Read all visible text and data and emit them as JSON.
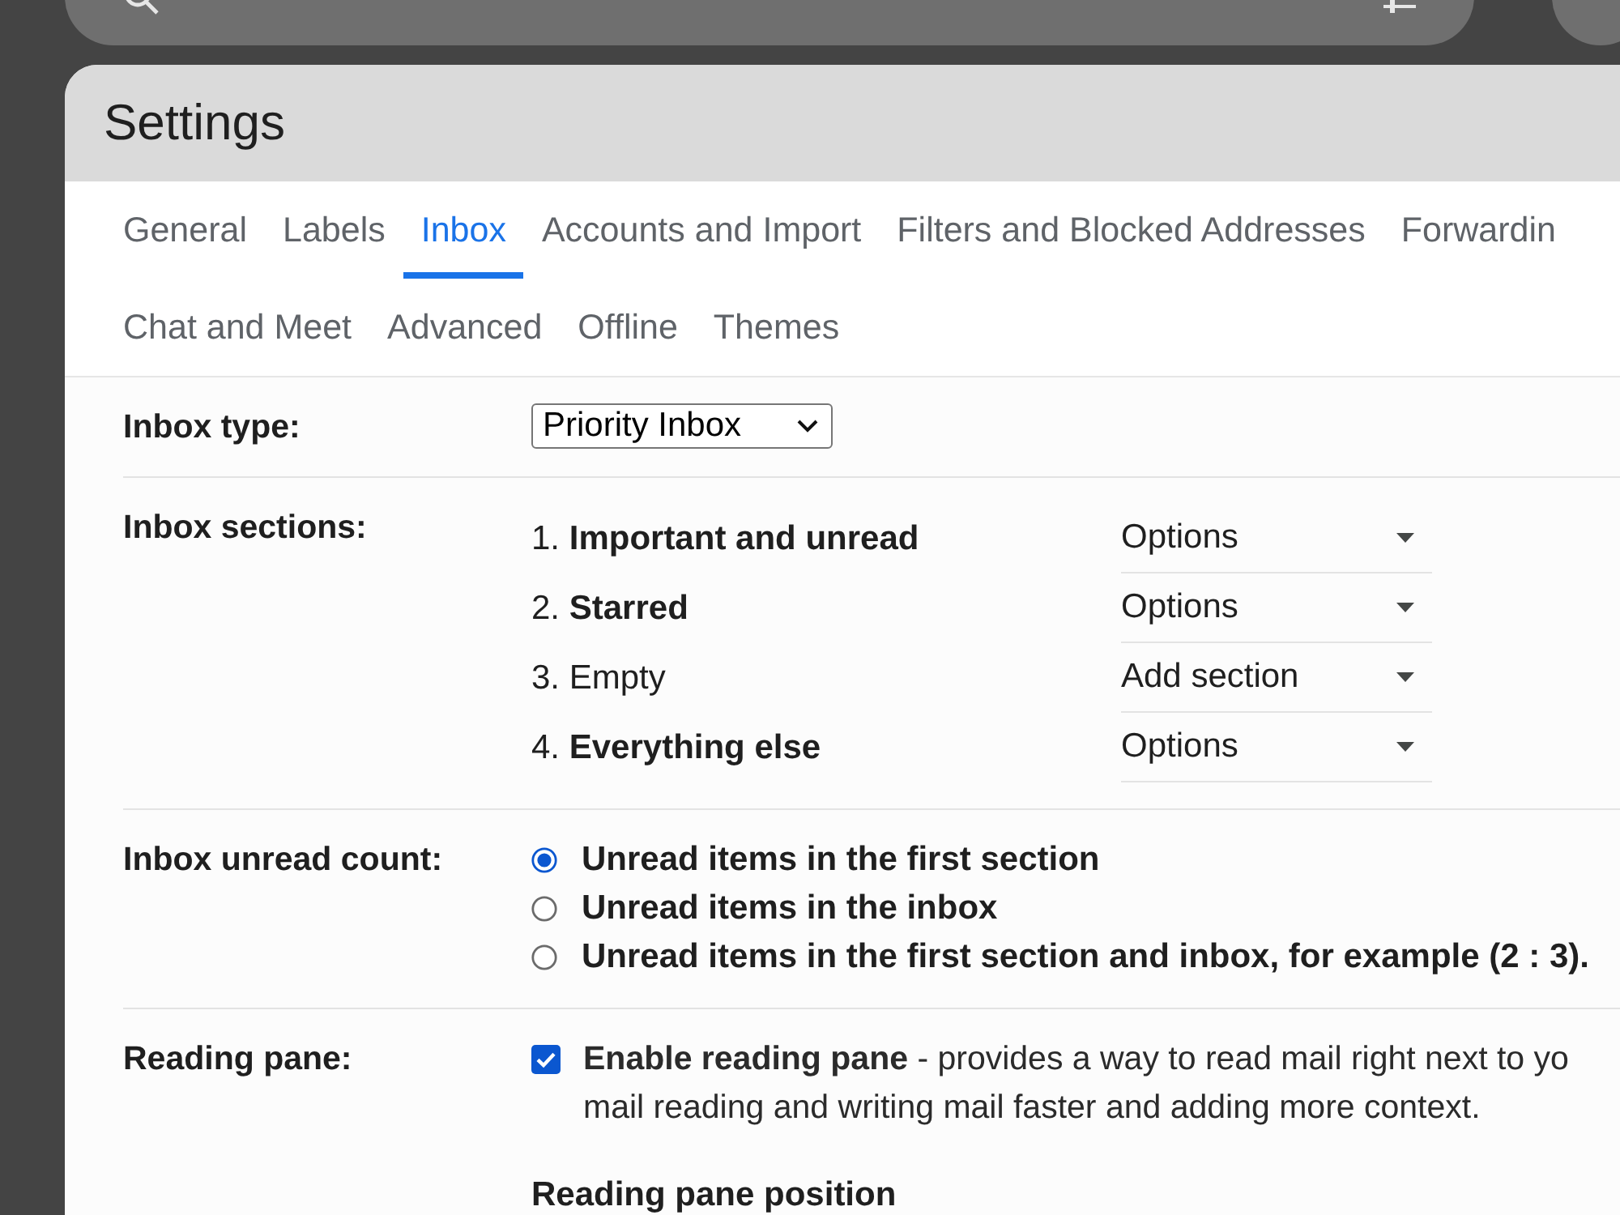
{
  "header": {
    "title": "Settings"
  },
  "tab_rows": [
    [
      {
        "label": "General",
        "selected": false
      },
      {
        "label": "Labels",
        "selected": false
      },
      {
        "label": "Inbox",
        "selected": true
      },
      {
        "label": "Accounts and Import",
        "selected": false
      },
      {
        "label": "Filters and Blocked Addresses",
        "selected": false
      },
      {
        "label": "Forwardin",
        "selected": false
      }
    ],
    [
      {
        "label": "Chat and Meet",
        "selected": false
      },
      {
        "label": "Advanced",
        "selected": false
      },
      {
        "label": "Offline",
        "selected": false
      },
      {
        "label": "Themes",
        "selected": false
      }
    ]
  ],
  "settings": [
    {
      "kind": "select",
      "label": "Inbox type:",
      "value": "Priority Inbox"
    },
    {
      "kind": "sections",
      "label": "Inbox sections:",
      "sections": [
        {
          "text": "1. **Important and unread**",
          "action": "Options"
        },
        {
          "text": "2. **Starred**",
          "action": "Options"
        },
        {
          "text": "3. Empty",
          "action": "Add section"
        },
        {
          "text": "4. **Everything else**",
          "action": "Options"
        }
      ]
    },
    {
      "kind": "radio",
      "label": "Inbox unread count:",
      "options": [
        {
          "text": "Unread items in the first section",
          "selected": true
        },
        {
          "text": "Unread items in the inbox",
          "selected": false
        },
        {
          "text": "Unread items in the first section and inbox, for example (2 : 3).",
          "selected": false
        }
      ]
    },
    {
      "kind": "checkbox",
      "label": "Reading pane:",
      "checked": true,
      "description": [
        "**Enable reading pane** - provides a way to read mail right next to yo",
        "mail reading and writing mail faster and adding more context."
      ],
      "subheading": "Reading pane position"
    }
  ]
}
